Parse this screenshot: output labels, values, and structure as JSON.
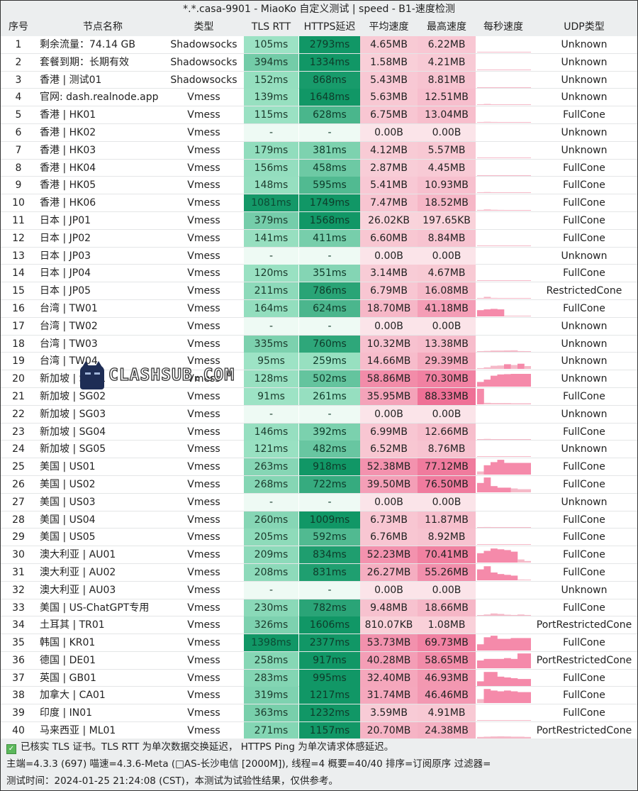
{
  "window": {
    "title": "*.*.casa-9901 - MiaoKo 自定义测试 | speed - B1-速度检测"
  },
  "colors": {
    "header_bg": "#eceeef",
    "tls_light": "#a6e6c9",
    "https_dark": "#129a68",
    "speed_pink": "#f7c6d0",
    "speed_hot": "#f07a9c",
    "spark_pink": "#f598b2",
    "empty_green": "#eefaf4",
    "empty_pink": "#fae3e8"
  },
  "table": {
    "headers": {
      "idx": "序号",
      "name": "节点名称",
      "type": "类型",
      "tls": "TLS RTT",
      "https": "HTTPS延迟",
      "avg": "平均速度",
      "max": "最高速度",
      "spark": "每秒速度",
      "udp": "UDP类型"
    },
    "rows": [
      {
        "idx": "1",
        "name": "剩余流量：74.14 GB",
        "type": "Shadowsocks",
        "tls": "105ms",
        "https": "2793ms",
        "avg": "4.65MB",
        "max": "6.22MB",
        "udp": "Unknown",
        "spark": [
          0.02,
          0.03,
          0.03,
          0.03,
          0.02,
          0.03,
          0.03,
          0.02
        ]
      },
      {
        "idx": "2",
        "name": "套餐到期：长期有效",
        "type": "Shadowsocks",
        "tls": "394ms",
        "https": "1334ms",
        "avg": "1.58MB",
        "max": "4.21MB",
        "udp": "Unknown",
        "spark": [
          0.01,
          0.02,
          0.02,
          0.02,
          0.02,
          0.01,
          0.01,
          0.01
        ]
      },
      {
        "idx": "3",
        "name": "香港 | 测试01",
        "type": "Shadowsocks",
        "tls": "152ms",
        "https": "868ms",
        "avg": "5.43MB",
        "max": "8.81MB",
        "udp": "Unknown",
        "spark": [
          0.02,
          0.03,
          0.03,
          0.03,
          0.03,
          0.02,
          0.03,
          0.03
        ]
      },
      {
        "idx": "4",
        "name": "官网: dash.realnode.app",
        "type": "Vmess",
        "tls": "139ms",
        "https": "1648ms",
        "avg": "5.63MB",
        "max": "12.51MB",
        "udp": "Unknown",
        "spark": [
          0.03,
          0.07,
          0.04,
          0.03,
          0.03,
          0.03,
          0.03,
          0.03
        ]
      },
      {
        "idx": "5",
        "name": "香港 | HK01",
        "type": "Vmess",
        "tls": "115ms",
        "https": "628ms",
        "avg": "6.75MB",
        "max": "13.04MB",
        "udp": "FullCone",
        "spark": [
          0.03,
          0.06,
          0.05,
          0.04,
          0.03,
          0.03,
          0.03,
          0.03
        ]
      },
      {
        "idx": "6",
        "name": "香港 | HK02",
        "type": "Vmess",
        "tls": "-",
        "https": "-",
        "avg": "0.00B",
        "max": "0.00B",
        "udp": "Unknown",
        "spark": []
      },
      {
        "idx": "7",
        "name": "香港 | HK03",
        "type": "Vmess",
        "tls": "179ms",
        "https": "381ms",
        "avg": "4.12MB",
        "max": "5.57MB",
        "udp": "Unknown",
        "spark": [
          0.02,
          0.03,
          0.03,
          0.03,
          0.03,
          0.03,
          0.02,
          0.02
        ]
      },
      {
        "idx": "8",
        "name": "香港 | HK04",
        "type": "Vmess",
        "tls": "156ms",
        "https": "458ms",
        "avg": "2.87MB",
        "max": "4.45MB",
        "udp": "FullCone",
        "spark": [
          0.01,
          0.02,
          0.02,
          0.02,
          0.01,
          0.02,
          0.02,
          0.01
        ]
      },
      {
        "idx": "9",
        "name": "香港 | HK05",
        "type": "Vmess",
        "tls": "148ms",
        "https": "595ms",
        "avg": "5.41MB",
        "max": "10.93MB",
        "udp": "FullCone",
        "spark": [
          0.03,
          0.06,
          0.04,
          0.03,
          0.03,
          0.03,
          0.03,
          0.03
        ]
      },
      {
        "idx": "10",
        "name": "香港 | HK06",
        "type": "Vmess",
        "tls": "1081ms",
        "https": "1749ms",
        "avg": "7.47MB",
        "max": "18.52MB",
        "udp": "FullCone",
        "spark": [
          0.05,
          0.08,
          0.06,
          0.05,
          0.04,
          0.04,
          0.04,
          0.04
        ]
      },
      {
        "idx": "11",
        "name": "日本 | JP01",
        "type": "Vmess",
        "tls": "379ms",
        "https": "1568ms",
        "avg": "26.02KB",
        "max": "197.65KB",
        "udp": "FullCone",
        "spark": []
      },
      {
        "idx": "12",
        "name": "日本 | JP02",
        "type": "Vmess",
        "tls": "141ms",
        "https": "411ms",
        "avg": "6.60MB",
        "max": "8.84MB",
        "udp": "FullCone",
        "spark": [
          0.03,
          0.04,
          0.04,
          0.04,
          0.04,
          0.04,
          0.03,
          0.03
        ]
      },
      {
        "idx": "13",
        "name": "日本 | JP03",
        "type": "Vmess",
        "tls": "-",
        "https": "-",
        "avg": "0.00B",
        "max": "0.00B",
        "udp": "Unknown",
        "spark": []
      },
      {
        "idx": "14",
        "name": "日本 | JP04",
        "type": "Vmess",
        "tls": "120ms",
        "https": "351ms",
        "avg": "3.14MB",
        "max": "4.67MB",
        "udp": "FullCone",
        "spark": [
          0.01,
          0.02,
          0.02,
          0.02,
          0.02,
          0.02,
          0.01,
          0.01
        ]
      },
      {
        "idx": "15",
        "name": "日本 | JP05",
        "type": "Vmess",
        "tls": "211ms",
        "https": "786ms",
        "avg": "6.79MB",
        "max": "16.08MB",
        "udp": "RestrictedCone",
        "spark": [
          0.03,
          0.12,
          0.05,
          0.04,
          0.03,
          0.03,
          0.03,
          0.03
        ]
      },
      {
        "idx": "16",
        "name": "台湾 | TW01",
        "type": "Vmess",
        "tls": "164ms",
        "https": "624ms",
        "avg": "18.70MB",
        "max": "41.18MB",
        "udp": "FullCone",
        "spark": [
          0.4,
          0.45,
          0.48,
          0.45,
          0,
          0,
          0,
          0
        ]
      },
      {
        "idx": "17",
        "name": "台湾 | TW02",
        "type": "Vmess",
        "tls": "-",
        "https": "-",
        "avg": "0.00B",
        "max": "0.00B",
        "udp": "Unknown",
        "spark": []
      },
      {
        "idx": "18",
        "name": "台湾 | TW03",
        "type": "Vmess",
        "tls": "335ms",
        "https": "760ms",
        "avg": "10.32MB",
        "max": "13.38MB",
        "udp": "Unknown",
        "spark": [
          0.03,
          0.06,
          0.08,
          0.08,
          0.09,
          0.1,
          0.05,
          0.03
        ]
      },
      {
        "idx": "19",
        "name": "台湾 | TW04",
        "type": "Vmess",
        "tls": "95ms",
        "https": "259ms",
        "avg": "14.66MB",
        "max": "29.39MB",
        "udp": "Unknown",
        "spark": [
          0.05,
          0.1,
          0.2,
          0.22,
          0.3,
          0.25,
          0.33,
          0.18
        ]
      },
      {
        "idx": "20",
        "name": "新加坡 | SG01",
        "type": "Vmess",
        "tls": "128ms",
        "https": "502ms",
        "avg": "58.86MB",
        "max": "70.30MB",
        "udp": "Unknown",
        "spark": [
          0.3,
          0.45,
          0.7,
          0.78,
          0.8,
          0.82,
          0.82,
          0.82
        ]
      },
      {
        "idx": "21",
        "name": "新加坡 | SG02",
        "type": "Vmess",
        "tls": "91ms",
        "https": "261ms",
        "avg": "35.95MB",
        "max": "88.33MB",
        "udp": "FullCone",
        "spark": [
          1.0,
          0.1,
          0.08,
          0.08,
          0.08,
          0.07,
          0.07,
          0.07
        ]
      },
      {
        "idx": "22",
        "name": "新加坡 | SG03",
        "type": "Vmess",
        "tls": "-",
        "https": "-",
        "avg": "0.00B",
        "max": "0.00B",
        "udp": "Unknown",
        "spark": []
      },
      {
        "idx": "23",
        "name": "新加坡 | SG04",
        "type": "Vmess",
        "tls": "146ms",
        "https": "392ms",
        "avg": "6.99MB",
        "max": "12.66MB",
        "udp": "FullCone",
        "spark": [
          0.02,
          0.06,
          0.04,
          0.03,
          0.03,
          0.03,
          0.03,
          0.03
        ]
      },
      {
        "idx": "24",
        "name": "新加坡 | SG05",
        "type": "Vmess",
        "tls": "121ms",
        "https": "482ms",
        "avg": "6.52MB",
        "max": "8.76MB",
        "udp": "Unknown",
        "spark": [
          0.03,
          0.04,
          0.04,
          0.04,
          0.04,
          0.04,
          0.03,
          0.03
        ]
      },
      {
        "idx": "25",
        "name": "美国 | US01",
        "type": "Vmess",
        "tls": "263ms",
        "https": "918ms",
        "avg": "52.38MB",
        "max": "77.12MB",
        "udp": "FullCone",
        "spark": [
          0.2,
          0.6,
          0.8,
          0.95,
          0.75,
          0.75,
          0.75,
          0.75
        ]
      },
      {
        "idx": "26",
        "name": "美国 | US02",
        "type": "Vmess",
        "tls": "268ms",
        "https": "722ms",
        "avg": "39.50MB",
        "max": "76.50MB",
        "udp": "FullCone",
        "spark": [
          0.6,
          0.95,
          0.4,
          0.3,
          0.3,
          0.25,
          0.2,
          0.2
        ]
      },
      {
        "idx": "27",
        "name": "美国 | US03",
        "type": "Vmess",
        "tls": "-",
        "https": "-",
        "avg": "0.00B",
        "max": "0.00B",
        "udp": "Unknown",
        "spark": []
      },
      {
        "idx": "28",
        "name": "美国 | US04",
        "type": "Vmess",
        "tls": "260ms",
        "https": "1009ms",
        "avg": "6.73MB",
        "max": "11.87MB",
        "udp": "FullCone",
        "spark": [
          0.02,
          0.05,
          0.04,
          0.03,
          0.03,
          0.03,
          0.03,
          0.03
        ]
      },
      {
        "idx": "29",
        "name": "美国 | US05",
        "type": "Vmess",
        "tls": "205ms",
        "https": "592ms",
        "avg": "6.76MB",
        "max": "8.92MB",
        "udp": "FullCone",
        "spark": [
          0.03,
          0.04,
          0.04,
          0.04,
          0.04,
          0.04,
          0.03,
          0.03
        ]
      },
      {
        "idx": "30",
        "name": "澳大利亚 | AU01",
        "type": "Vmess",
        "tls": "209ms",
        "https": "834ms",
        "avg": "52.23MB",
        "max": "70.41MB",
        "udp": "FullCone",
        "spark": [
          0.6,
          0.75,
          0.9,
          0.85,
          0.8,
          0.7,
          0.2,
          0.1
        ]
      },
      {
        "idx": "31",
        "name": "澳大利亚 | AU02",
        "type": "Vmess",
        "tls": "208ms",
        "https": "831ms",
        "avg": "26.27MB",
        "max": "55.26MB",
        "udp": "FullCone",
        "spark": [
          0.7,
          0.9,
          0.5,
          0.4,
          0.35,
          0.3,
          0.05,
          0.03
        ]
      },
      {
        "idx": "32",
        "name": "澳大利亚 | AU03",
        "type": "Vmess",
        "tls": "-",
        "https": "-",
        "avg": "0.00B",
        "max": "0.00B",
        "udp": "Unknown",
        "spark": []
      },
      {
        "idx": "33",
        "name": "美国 | US-ChatGPT专用",
        "type": "Vmess",
        "tls": "230ms",
        "https": "782ms",
        "avg": "9.48MB",
        "max": "18.66MB",
        "udp": "FullCone",
        "spark": [
          0.03,
          0.08,
          0.15,
          0.12,
          0.07,
          0.05,
          0.08,
          0.05
        ]
      },
      {
        "idx": "34",
        "name": "土耳其 | TR01",
        "type": "Vmess",
        "tls": "326ms",
        "https": "1606ms",
        "avg": "810.07KB",
        "max": "1.08MB",
        "udp": "PortRestrictedCone",
        "spark": []
      },
      {
        "idx": "35",
        "name": "韩国 | KR01",
        "type": "Vmess",
        "tls": "1398ms",
        "https": "2377ms",
        "avg": "53.73MB",
        "max": "69.73MB",
        "udp": "FullCone",
        "spark": [
          0.4,
          0.85,
          0.95,
          0.75,
          0.75,
          0.8,
          0.8,
          0.8
        ]
      },
      {
        "idx": "36",
        "name": "德国 | DE01",
        "type": "Vmess",
        "tls": "258ms",
        "https": "917ms",
        "avg": "40.28MB",
        "max": "58.65MB",
        "udp": "PortRestrictedCone",
        "spark": [
          0.5,
          0.6,
          0.6,
          0.6,
          0.65,
          0.6,
          0.95,
          0.95
        ]
      },
      {
        "idx": "37",
        "name": "英国 | GB01",
        "type": "Vmess",
        "tls": "283ms",
        "https": "995ms",
        "avg": "32.40MB",
        "max": "46.93MB",
        "udp": "FullCone",
        "spark": [
          0.3,
          0.9,
          0.9,
          0.6,
          0.55,
          0.5,
          0.45,
          0.45
        ]
      },
      {
        "idx": "38",
        "name": "加拿大 | CA01",
        "type": "Vmess",
        "tls": "319ms",
        "https": "1217ms",
        "avg": "31.74MB",
        "max": "46.46MB",
        "udp": "FullCone",
        "spark": [
          0.25,
          0.9,
          0.8,
          0.75,
          0.8,
          0.75,
          0.7,
          0.7
        ]
      },
      {
        "idx": "39",
        "name": "印度 | IN01",
        "type": "Vmess",
        "tls": "363ms",
        "https": "1232ms",
        "avg": "3.59MB",
        "max": "4.91MB",
        "udp": "FullCone",
        "spark": [
          0.02,
          0.02,
          0.02,
          0.02,
          0.02,
          0.02,
          0.02,
          0.02
        ]
      },
      {
        "idx": "40",
        "name": "马来西亚 | ML01",
        "type": "Vmess",
        "tls": "271ms",
        "https": "1157ms",
        "avg": "20.70MB",
        "max": "24.38MB",
        "udp": "PortRestrictedCone",
        "spark": [
          0.1,
          0.12,
          0.13,
          0.14,
          0.13,
          0.12,
          0.12,
          0.1
        ]
      }
    ]
  },
  "footer": {
    "line1": "已核实 TLS 证书。TLS RTT 为单次数据交换延迟， HTTPS Ping 为单次请求体感延迟。",
    "line2": "主端=4.3.3 (697) 喵速=4.3.6-Meta (□AS-长沙电信 [2000M]), 线程=4 概要=40/40 排序=订阅原序 过滤器=",
    "line3": "测试时间：2024-01-25 21:24:08 (CST)，本测试为试验性结果，仅供参考。"
  },
  "watermark": {
    "text": "CLASHSUB.COM",
    "icon": "cat-mascot-icon"
  }
}
